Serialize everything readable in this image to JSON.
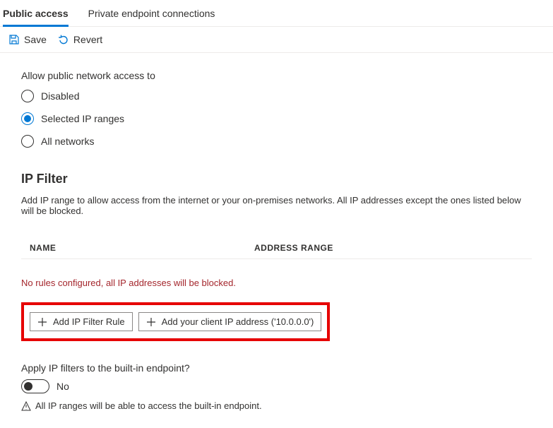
{
  "tabs": [
    {
      "label": "Public access",
      "active": true
    },
    {
      "label": "Private endpoint connections",
      "active": false
    }
  ],
  "toolbar": {
    "save_label": "Save",
    "revert_label": "Revert"
  },
  "public_access": {
    "label": "Allow public network access to",
    "options": [
      {
        "label": "Disabled",
        "selected": false
      },
      {
        "label": "Selected IP ranges",
        "selected": true
      },
      {
        "label": "All networks",
        "selected": false
      }
    ]
  },
  "ip_filter": {
    "heading": "IP Filter",
    "description": "Add IP range to allow access from the internet or your on-premises networks. All IP addresses except the ones listed below will be blocked.",
    "columns": {
      "name": "NAME",
      "range": "ADDRESS RANGE"
    },
    "empty_message": "No rules configured, all IP addresses will be blocked.",
    "add_rule_label": "Add IP Filter Rule",
    "add_client_label": "Add your client IP address ('10.0.0.0')"
  },
  "apply_builtin": {
    "label": "Apply IP filters to the built-in endpoint?",
    "state": "No",
    "info": "All IP ranges will be able to access the built-in endpoint."
  }
}
